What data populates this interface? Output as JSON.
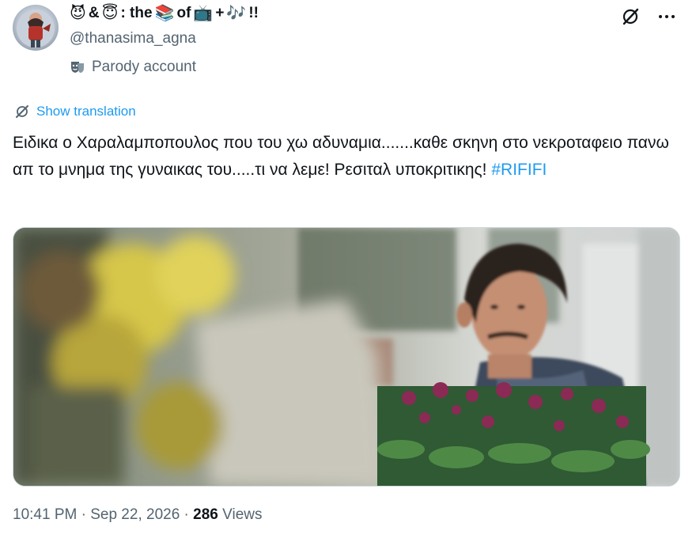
{
  "author": {
    "name_parts": [
      "😈",
      "&",
      "😇",
      ": the",
      "📚",
      "of",
      "📺",
      "+",
      "🎶",
      "!!"
    ],
    "handle": "@thanasima_agna",
    "label": "Parody account"
  },
  "icons": {
    "grok": "grok-icon",
    "more": "more-icon",
    "parody": "parody-mask-icon",
    "translate": "translate-icon"
  },
  "translate_label": "Show translation",
  "tweet": {
    "text": "Ειδικα ο Χαραλαμποπουλος που του χω αδυναμια.......καθε σκηνη στο νεκροταφειο πανω απ το μνημα της γυναικας του.....τι να λεμε! Ρεσιταλ υποκριτικης! ",
    "hashtag": "#RIFIFI"
  },
  "meta": {
    "time": "10:41 PM",
    "sep": "·",
    "date": "Sep 22, 2026",
    "views_count": "286",
    "views_label": "Views"
  },
  "colors": {
    "accent": "#1d9bf0",
    "secondary_text": "#536471",
    "primary_text": "#0f1419"
  }
}
